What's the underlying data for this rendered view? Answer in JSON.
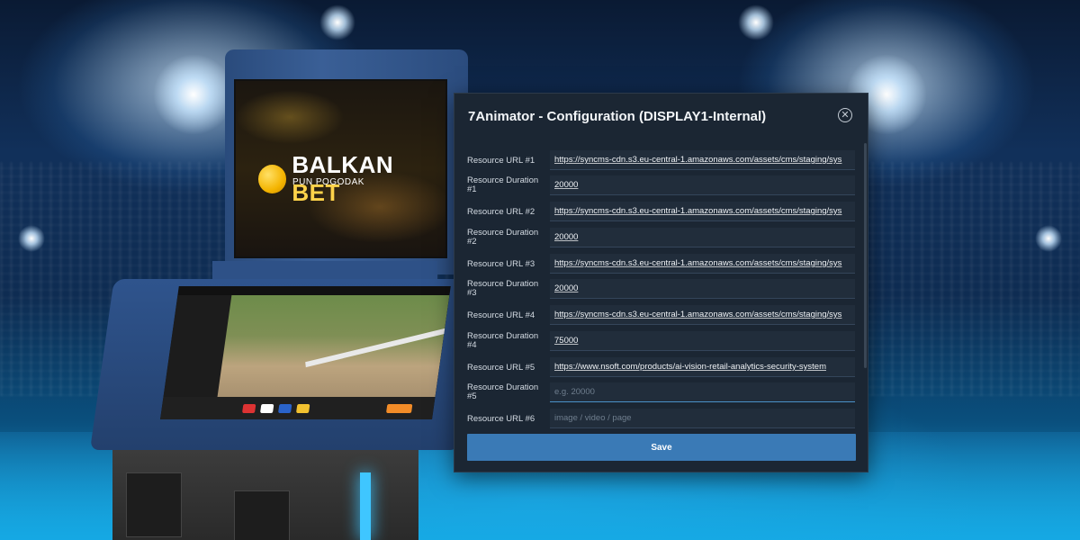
{
  "kiosk": {
    "brand_name_1": "BALKAN",
    "brand_name_2": "BET",
    "brand_tagline": "PUN POGODAK"
  },
  "dialog": {
    "title": "7Animator - Configuration (DISPLAY1-Internal)",
    "save_label": "Save",
    "rows": [
      {
        "label": "Resource URL #1",
        "value": "https://syncms-cdn.s3.eu-central-1.amazonaws.com/assets/cms/staging/sys",
        "placeholder": ""
      },
      {
        "label": "Resource Duration #1",
        "value": "20000",
        "placeholder": ""
      },
      {
        "label": "Resource URL #2",
        "value": "https://syncms-cdn.s3.eu-central-1.amazonaws.com/assets/cms/staging/sys",
        "placeholder": ""
      },
      {
        "label": "Resource Duration #2",
        "value": "20000",
        "placeholder": ""
      },
      {
        "label": "Resource URL #3",
        "value": "https://syncms-cdn.s3.eu-central-1.amazonaws.com/assets/cms/staging/sys",
        "placeholder": ""
      },
      {
        "label": "Resource Duration #3",
        "value": "20000",
        "placeholder": ""
      },
      {
        "label": "Resource URL #4",
        "value": "https://syncms-cdn.s3.eu-central-1.amazonaws.com/assets/cms/staging/sys",
        "placeholder": ""
      },
      {
        "label": "Resource Duration #4",
        "value": "75000",
        "placeholder": ""
      },
      {
        "label": "Resource URL #5",
        "value": "https://www.nsoft.com/products/ai-vision-retail-analytics-security-system",
        "placeholder": ""
      },
      {
        "label": "Resource Duration #5",
        "value": "",
        "placeholder": "e.g. 20000"
      },
      {
        "label": "Resource URL #6",
        "value": "",
        "placeholder": "image / video / page"
      }
    ]
  },
  "colors": {
    "dialog_bg": "#1b2633",
    "input_bg": "#212d3b",
    "accent": "#3a7ab6"
  },
  "icons": {
    "close": "close-circle-icon"
  }
}
